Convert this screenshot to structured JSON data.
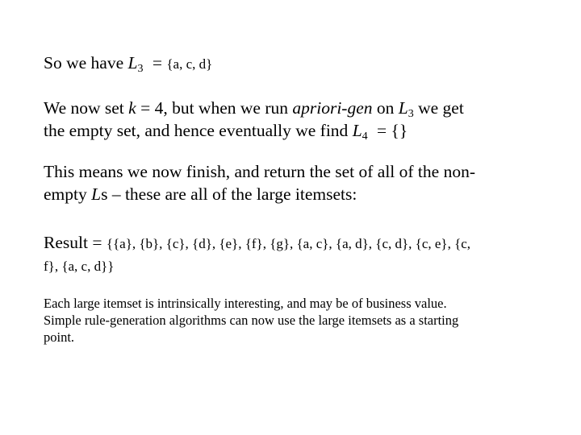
{
  "slide": {
    "p1": {
      "prefix": "So we have ",
      "var": "L",
      "sub": "3",
      "eq": " = ",
      "set": "{a, c, d}"
    },
    "p2": {
      "line1_a": "We now set ",
      "k": "k",
      "line1_b": " = 4, but when we run ",
      "func": "apriori-gen",
      "line1_c": " on ",
      "var": "L",
      "sub": "3",
      "line1_d": " we get",
      "line2_a": "the empty set, and hence eventually we find ",
      "var2": "L",
      "sub2": "4",
      "line2_b": " = {}"
    },
    "p3": {
      "line1": "This means we now finish, and return the set of all of the non-",
      "line2_a": "empty ",
      "var": "L",
      "line2_b": "s – these are all of the large itemsets:"
    },
    "p4": {
      "label": "Result = ",
      "line1_set": "{{a}, {b}, {c}, {d}, {e}, {f}, {g}, {a, c}, {a, d}, {c, d},  {c, e}, {c,",
      "line2_set": "f}, {a, c, d}}"
    },
    "p5": {
      "line1": "Each large itemset is intrinsically interesting, and may be of business value.",
      "line2": "Simple rule-generation algorithms can now use the large itemsets as a starting",
      "line3": "point."
    }
  }
}
